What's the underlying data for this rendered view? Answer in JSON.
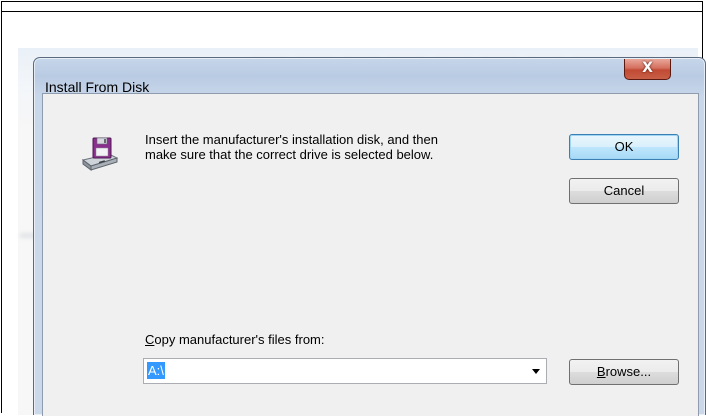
{
  "dialog": {
    "title": "Install From Disk",
    "close_label": "X",
    "message_line1": "Insert the manufacturer's installation disk, and then",
    "message_line2": "make sure that the correct drive is selected below.",
    "ok_label": "OK",
    "cancel_label": "Cancel",
    "copy_label_first": "C",
    "copy_label_rest": "opy manufacturer's files from:",
    "path_value": "A:\\",
    "browse_label_first": "B",
    "browse_label_rest": "rowse..."
  },
  "icons": {
    "disk": "floppy-drive-icon",
    "dropdown": "chevron-down-icon"
  },
  "colors": {
    "accent_selection": "#3399ff",
    "close_button": "#c14a34",
    "title_bar": "#b9cbe3"
  }
}
